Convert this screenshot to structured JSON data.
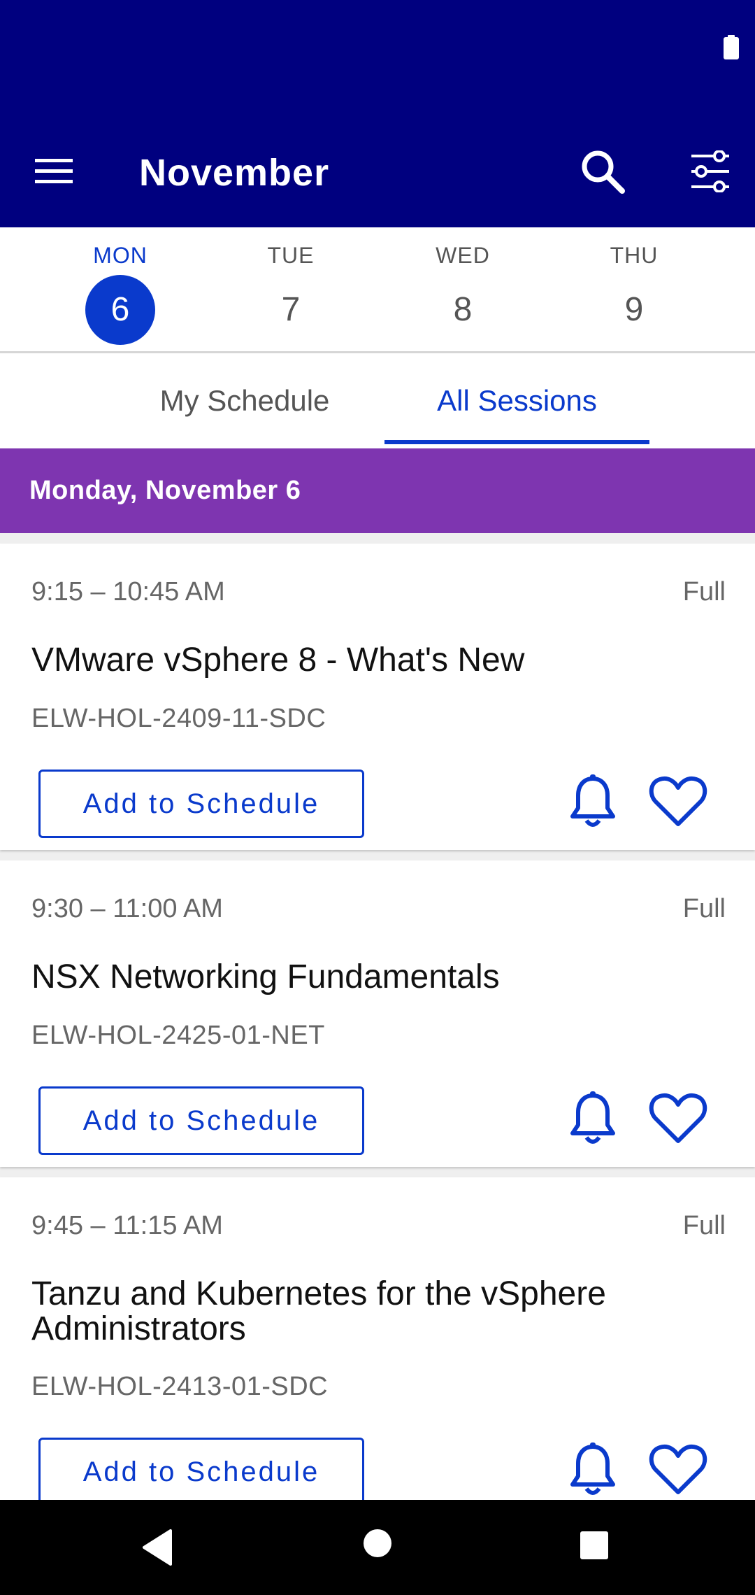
{
  "header": {
    "title": "November",
    "menu_icon": "hamburger-menu-icon",
    "search_icon": "search-icon",
    "filter_icon": "filter-sliders-icon",
    "background_color": "#00007f"
  },
  "status_bar": {
    "battery_icon": "battery-icon"
  },
  "days": [
    {
      "name": "MON",
      "number": "6",
      "selected": true
    },
    {
      "name": "TUE",
      "number": "7",
      "selected": false
    },
    {
      "name": "WED",
      "number": "8",
      "selected": false
    },
    {
      "name": "THU",
      "number": "9",
      "selected": false
    }
  ],
  "tabs": [
    {
      "label": "My Schedule",
      "active": false
    },
    {
      "label": "All Sessions",
      "active": true
    }
  ],
  "date_banner": {
    "label": "Monday, November 6",
    "color": "#7e35b0"
  },
  "sessions": [
    {
      "time": "9:15 – 10:45 AM",
      "status": "Full",
      "title": "VMware vSphere 8 - What's New",
      "code": "ELW-HOL-2409-11-SDC",
      "button_label": "Add to Schedule"
    },
    {
      "time": "9:30 – 11:00 AM",
      "status": "Full",
      "title": "NSX Networking Fundamentals",
      "code": "ELW-HOL-2425-01-NET",
      "button_label": "Add to Schedule"
    },
    {
      "time": "9:45 – 11:15 AM",
      "status": "Full",
      "title": "Tanzu and Kubernetes for the vSphere Administrators",
      "code": "ELW-HOL-2413-01-SDC",
      "button_label": "Add to Schedule"
    }
  ],
  "accent_color": "#0a3acc",
  "nav": {
    "back_icon": "back-triangle-icon",
    "home_icon": "home-circle-icon",
    "recent_icon": "recent-apps-square-icon"
  }
}
